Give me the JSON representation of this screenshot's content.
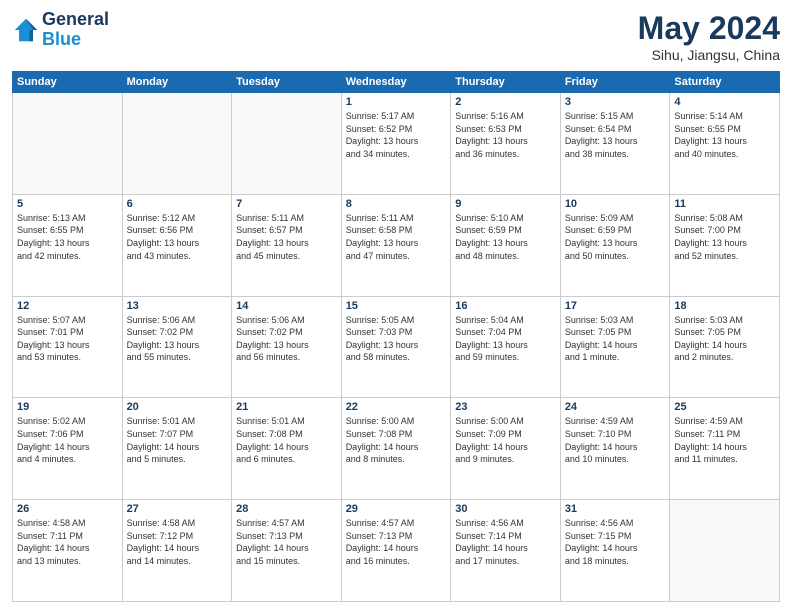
{
  "header": {
    "logo_line1": "General",
    "logo_line2": "Blue",
    "title": "May 2024",
    "subtitle": "Sihu, Jiangsu, China"
  },
  "weekdays": [
    "Sunday",
    "Monday",
    "Tuesday",
    "Wednesday",
    "Thursday",
    "Friday",
    "Saturday"
  ],
  "weeks": [
    [
      {
        "day": "",
        "info": ""
      },
      {
        "day": "",
        "info": ""
      },
      {
        "day": "",
        "info": ""
      },
      {
        "day": "1",
        "info": "Sunrise: 5:17 AM\nSunset: 6:52 PM\nDaylight: 13 hours\nand 34 minutes."
      },
      {
        "day": "2",
        "info": "Sunrise: 5:16 AM\nSunset: 6:53 PM\nDaylight: 13 hours\nand 36 minutes."
      },
      {
        "day": "3",
        "info": "Sunrise: 5:15 AM\nSunset: 6:54 PM\nDaylight: 13 hours\nand 38 minutes."
      },
      {
        "day": "4",
        "info": "Sunrise: 5:14 AM\nSunset: 6:55 PM\nDaylight: 13 hours\nand 40 minutes."
      }
    ],
    [
      {
        "day": "5",
        "info": "Sunrise: 5:13 AM\nSunset: 6:55 PM\nDaylight: 13 hours\nand 42 minutes."
      },
      {
        "day": "6",
        "info": "Sunrise: 5:12 AM\nSunset: 6:56 PM\nDaylight: 13 hours\nand 43 minutes."
      },
      {
        "day": "7",
        "info": "Sunrise: 5:11 AM\nSunset: 6:57 PM\nDaylight: 13 hours\nand 45 minutes."
      },
      {
        "day": "8",
        "info": "Sunrise: 5:11 AM\nSunset: 6:58 PM\nDaylight: 13 hours\nand 47 minutes."
      },
      {
        "day": "9",
        "info": "Sunrise: 5:10 AM\nSunset: 6:59 PM\nDaylight: 13 hours\nand 48 minutes."
      },
      {
        "day": "10",
        "info": "Sunrise: 5:09 AM\nSunset: 6:59 PM\nDaylight: 13 hours\nand 50 minutes."
      },
      {
        "day": "11",
        "info": "Sunrise: 5:08 AM\nSunset: 7:00 PM\nDaylight: 13 hours\nand 52 minutes."
      }
    ],
    [
      {
        "day": "12",
        "info": "Sunrise: 5:07 AM\nSunset: 7:01 PM\nDaylight: 13 hours\nand 53 minutes."
      },
      {
        "day": "13",
        "info": "Sunrise: 5:06 AM\nSunset: 7:02 PM\nDaylight: 13 hours\nand 55 minutes."
      },
      {
        "day": "14",
        "info": "Sunrise: 5:06 AM\nSunset: 7:02 PM\nDaylight: 13 hours\nand 56 minutes."
      },
      {
        "day": "15",
        "info": "Sunrise: 5:05 AM\nSunset: 7:03 PM\nDaylight: 13 hours\nand 58 minutes."
      },
      {
        "day": "16",
        "info": "Sunrise: 5:04 AM\nSunset: 7:04 PM\nDaylight: 13 hours\nand 59 minutes."
      },
      {
        "day": "17",
        "info": "Sunrise: 5:03 AM\nSunset: 7:05 PM\nDaylight: 14 hours\nand 1 minute."
      },
      {
        "day": "18",
        "info": "Sunrise: 5:03 AM\nSunset: 7:05 PM\nDaylight: 14 hours\nand 2 minutes."
      }
    ],
    [
      {
        "day": "19",
        "info": "Sunrise: 5:02 AM\nSunset: 7:06 PM\nDaylight: 14 hours\nand 4 minutes."
      },
      {
        "day": "20",
        "info": "Sunrise: 5:01 AM\nSunset: 7:07 PM\nDaylight: 14 hours\nand 5 minutes."
      },
      {
        "day": "21",
        "info": "Sunrise: 5:01 AM\nSunset: 7:08 PM\nDaylight: 14 hours\nand 6 minutes."
      },
      {
        "day": "22",
        "info": "Sunrise: 5:00 AM\nSunset: 7:08 PM\nDaylight: 14 hours\nand 8 minutes."
      },
      {
        "day": "23",
        "info": "Sunrise: 5:00 AM\nSunset: 7:09 PM\nDaylight: 14 hours\nand 9 minutes."
      },
      {
        "day": "24",
        "info": "Sunrise: 4:59 AM\nSunset: 7:10 PM\nDaylight: 14 hours\nand 10 minutes."
      },
      {
        "day": "25",
        "info": "Sunrise: 4:59 AM\nSunset: 7:11 PM\nDaylight: 14 hours\nand 11 minutes."
      }
    ],
    [
      {
        "day": "26",
        "info": "Sunrise: 4:58 AM\nSunset: 7:11 PM\nDaylight: 14 hours\nand 13 minutes."
      },
      {
        "day": "27",
        "info": "Sunrise: 4:58 AM\nSunset: 7:12 PM\nDaylight: 14 hours\nand 14 minutes."
      },
      {
        "day": "28",
        "info": "Sunrise: 4:57 AM\nSunset: 7:13 PM\nDaylight: 14 hours\nand 15 minutes."
      },
      {
        "day": "29",
        "info": "Sunrise: 4:57 AM\nSunset: 7:13 PM\nDaylight: 14 hours\nand 16 minutes."
      },
      {
        "day": "30",
        "info": "Sunrise: 4:56 AM\nSunset: 7:14 PM\nDaylight: 14 hours\nand 17 minutes."
      },
      {
        "day": "31",
        "info": "Sunrise: 4:56 AM\nSunset: 7:15 PM\nDaylight: 14 hours\nand 18 minutes."
      },
      {
        "day": "",
        "info": ""
      }
    ]
  ]
}
